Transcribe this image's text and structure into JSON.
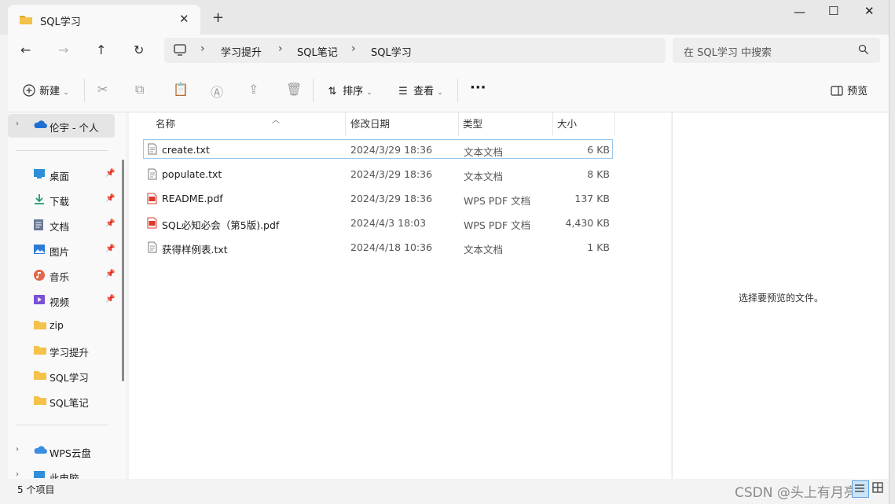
{
  "window": {
    "tab_title": "SQL学习",
    "new_tab_symbol": "+",
    "close_tab_symbol": "✕",
    "minimize_symbol": "—",
    "maximize_symbol": "☐",
    "close_symbol": "✕"
  },
  "address": {
    "back_symbol": "←",
    "forward_symbol": "→",
    "up_symbol": "↑",
    "refresh_symbol": "↻",
    "breadcrumbs": [
      "学习提升",
      "SQL笔记",
      "SQL学习"
    ],
    "search_placeholder": "在 SQL学习 中搜索"
  },
  "commandbar": {
    "new_label": "新建",
    "sort_label": "排序",
    "view_label": "查看",
    "more_symbol": "···",
    "preview_label": "预览"
  },
  "sidebar": {
    "home_item": "伦宇 - 个人",
    "pinned": [
      {
        "label": "桌面",
        "icon": "desktop-icon",
        "color": "#2f8fd8"
      },
      {
        "label": "下载",
        "icon": "download-icon",
        "color": "#1f9d6b"
      },
      {
        "label": "文档",
        "icon": "document-icon",
        "color": "#6b7a99"
      },
      {
        "label": "图片",
        "icon": "pictures-icon",
        "color": "#2b7bd6"
      },
      {
        "label": "音乐",
        "icon": "music-icon",
        "color": "#e2664b"
      },
      {
        "label": "视频",
        "icon": "video-icon",
        "color": "#7b4fd6"
      }
    ],
    "folders": [
      "zip",
      "学习提升",
      "SQL学习",
      "SQL笔记"
    ],
    "drives": [
      "WPS云盘",
      "此电脑"
    ]
  },
  "columns": {
    "name": "名称",
    "modified": "修改日期",
    "type": "类型",
    "size": "大小"
  },
  "files": [
    {
      "name": "create.txt",
      "modified": "2024/3/29 18:36",
      "type": "文本文档",
      "size": "6 KB",
      "icon": "text-file-icon"
    },
    {
      "name": "populate.txt",
      "modified": "2024/3/29 18:36",
      "type": "文本文档",
      "size": "8 KB",
      "icon": "text-file-icon"
    },
    {
      "name": "README.pdf",
      "modified": "2024/3/29 18:36",
      "type": "WPS PDF 文档",
      "size": "137 KB",
      "icon": "pdf-file-icon"
    },
    {
      "name": "SQL必知必会（第5版).pdf",
      "modified": "2024/4/3 18:03",
      "type": "WPS PDF 文档",
      "size": "4,430 KB",
      "icon": "pdf-file-icon"
    },
    {
      "name": "获得样例表.txt",
      "modified": "2024/4/18 10:36",
      "type": "文本文档",
      "size": "1 KB",
      "icon": "text-file-icon"
    }
  ],
  "preview": {
    "message": "选择要预览的文件。"
  },
  "status": {
    "item_count": "5 个项目"
  },
  "watermark": "CSDN @头上有月亮",
  "colors": {
    "folder": "#f4c14a",
    "selection_border": "#99c9ef",
    "pdf_red": "#d93a2b",
    "onedrive": "#1f6fd1"
  }
}
